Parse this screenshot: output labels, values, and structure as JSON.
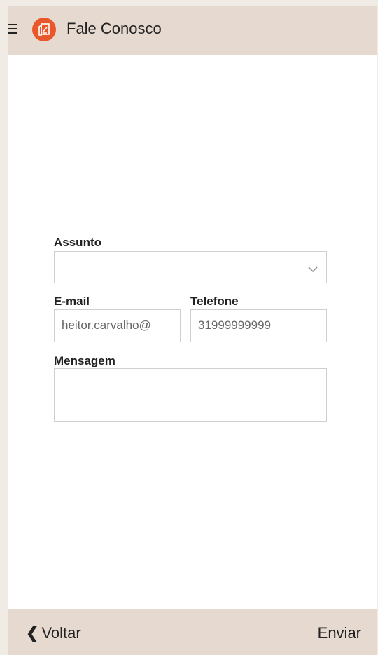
{
  "header": {
    "title": "Fale Conosco",
    "menu_icon": "hamburger-menu-icon",
    "logo_icon": "app-logo-icon",
    "accent_color": "#e8582a"
  },
  "form": {
    "assunto": {
      "label": "Assunto",
      "value": ""
    },
    "email": {
      "label": "E-mail",
      "value": "heitor.carvalho@"
    },
    "telefone": {
      "label": "Telefone",
      "value": "31999999999"
    },
    "mensagem": {
      "label": "Mensagem",
      "value": ""
    }
  },
  "footer": {
    "back_label": "Voltar",
    "back_icon": "chevron-left-icon",
    "send_label": "Enviar"
  }
}
